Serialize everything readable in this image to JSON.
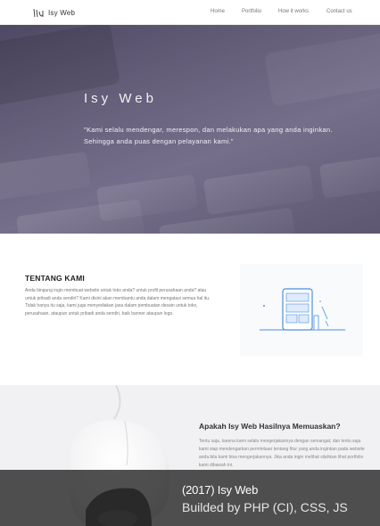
{
  "brand": {
    "name": "Isy Web"
  },
  "nav": {
    "home": "Home",
    "portfolio": "Portfolio",
    "how": "How it works",
    "contact": "Contact us"
  },
  "hero": {
    "title": "Isy Web",
    "quote": "\"Kami selalu mendengar, merespon, dan melakukan apa yang anda inginkan. Sehingga anda puas dengan pelayanan kami.\""
  },
  "about": {
    "title": "TENTANG KAMI",
    "text": "Anda bingung ingin membuat website untuk toko anda? untuk profil perusahaan anda? atau untuk pribadi anda sendiri? Kami disini akan membantu anda dalam mengatasi semua hal itu. Tidak hanya itu saja, kami juga menyediakan jasa dalam pembuatan desain untuk toko, perusahaan, ataupun untuk pribadi anda sendiri, baik banner ataupun logo."
  },
  "feature": {
    "title": "Apakah Isy Web Hasilnya Memuaskan?",
    "text": "Tentu saja, karena kami selalu mengerjakannya dengan semangat, dan tentu saja kami siap mendengarkan permintaan tentang fitur yang anda inginkan pada website anda bila kami bisa mengerjakannya. Jika anda ingin melihat silahkan lihat portfolio kami dibawah ini."
  },
  "caption": {
    "title": "(2017) Isy Web",
    "subtitle": "Builded by PHP (CI), CSS, JS"
  },
  "colors": {
    "hero_overlay": "#5d5872",
    "illustration_blue": "#4a90e2",
    "caption_bg": "#2a2a2a"
  }
}
